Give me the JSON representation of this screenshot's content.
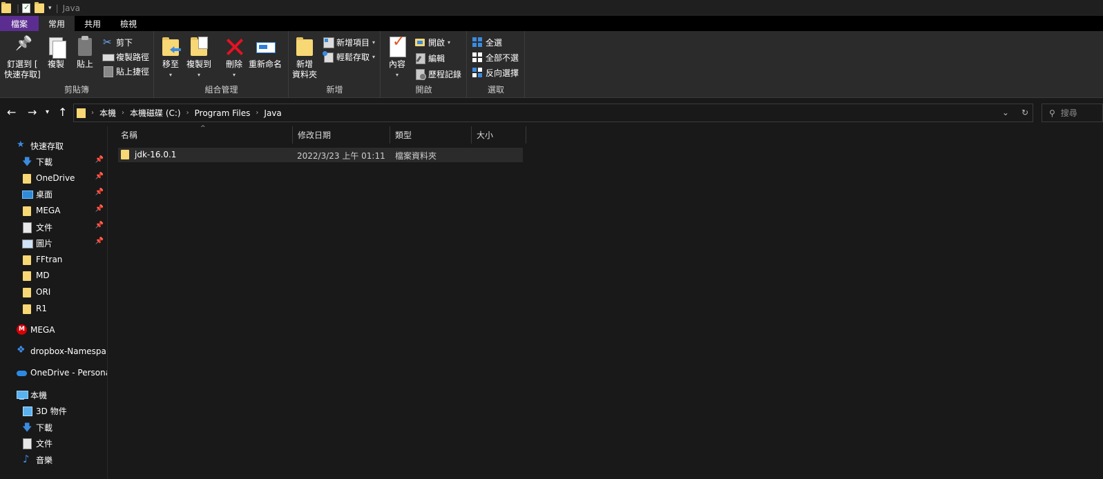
{
  "window": {
    "title": "Java"
  },
  "ribbon_tabs": [
    {
      "label": "檔案"
    },
    {
      "label": "常用"
    },
    {
      "label": "共用"
    },
    {
      "label": "檢視"
    }
  ],
  "clipboard": {
    "pin_label_1": "釘選到 [",
    "pin_label_2": "快速存取]",
    "copy": "複製",
    "paste": "貼上",
    "cut": "剪下",
    "copy_path": "複製路徑",
    "paste_shortcut": "貼上捷徑",
    "group": "剪貼簿"
  },
  "organize": {
    "move_to": "移至",
    "copy_to": "複製到",
    "delete": "刪除",
    "rename": "重新命名",
    "group": "組合管理"
  },
  "new": {
    "new_folder_1": "新增",
    "new_folder_2": "資料夾",
    "new_item": "新增項目",
    "easy_access": "輕鬆存取",
    "group": "新增"
  },
  "open": {
    "properties": "內容",
    "open": "開啟",
    "edit": "編輯",
    "history": "歷程記錄",
    "group": "開啟"
  },
  "select": {
    "select_all": "全選",
    "select_none": "全部不選",
    "invert": "反向選擇",
    "group": "選取"
  },
  "breadcrumb": [
    "本機",
    "本機磁碟 (C:)",
    "Program Files",
    "Java"
  ],
  "search": {
    "placeholder": "搜尋"
  },
  "nav_pane": {
    "quick_access": "快速存取",
    "quick_items": [
      {
        "label": "下載",
        "pinned": true
      },
      {
        "label": "OneDrive",
        "pinned": true
      },
      {
        "label": "桌面",
        "pinned": true
      },
      {
        "label": "MEGA",
        "pinned": true
      },
      {
        "label": "文件",
        "pinned": true
      },
      {
        "label": "圖片",
        "pinned": true
      },
      {
        "label": "FFtran",
        "pinned": false
      },
      {
        "label": "MD",
        "pinned": false
      },
      {
        "label": "ORI",
        "pinned": false
      },
      {
        "label": "R1",
        "pinned": false
      }
    ],
    "mega": "MEGA",
    "dropbox": "dropbox-Namespa",
    "onedrive_personal": "OneDrive - Personal",
    "this_pc": "本機",
    "pc_items": [
      {
        "label": "3D 物件"
      },
      {
        "label": "下載"
      },
      {
        "label": "文件"
      },
      {
        "label": "音樂"
      }
    ]
  },
  "columns": {
    "name": "名稱",
    "modified": "修改日期",
    "type": "類型",
    "size": "大小"
  },
  "files": [
    {
      "name": "jdk-16.0.1",
      "modified": "2022/3/23 上午 01:11",
      "type": "檔案資料夾",
      "size": ""
    }
  ],
  "colors": {
    "accent_file_tab": "#5c2d91",
    "folder": "#f8d775",
    "background": "#191919",
    "ribbon": "#2b2b2b"
  }
}
